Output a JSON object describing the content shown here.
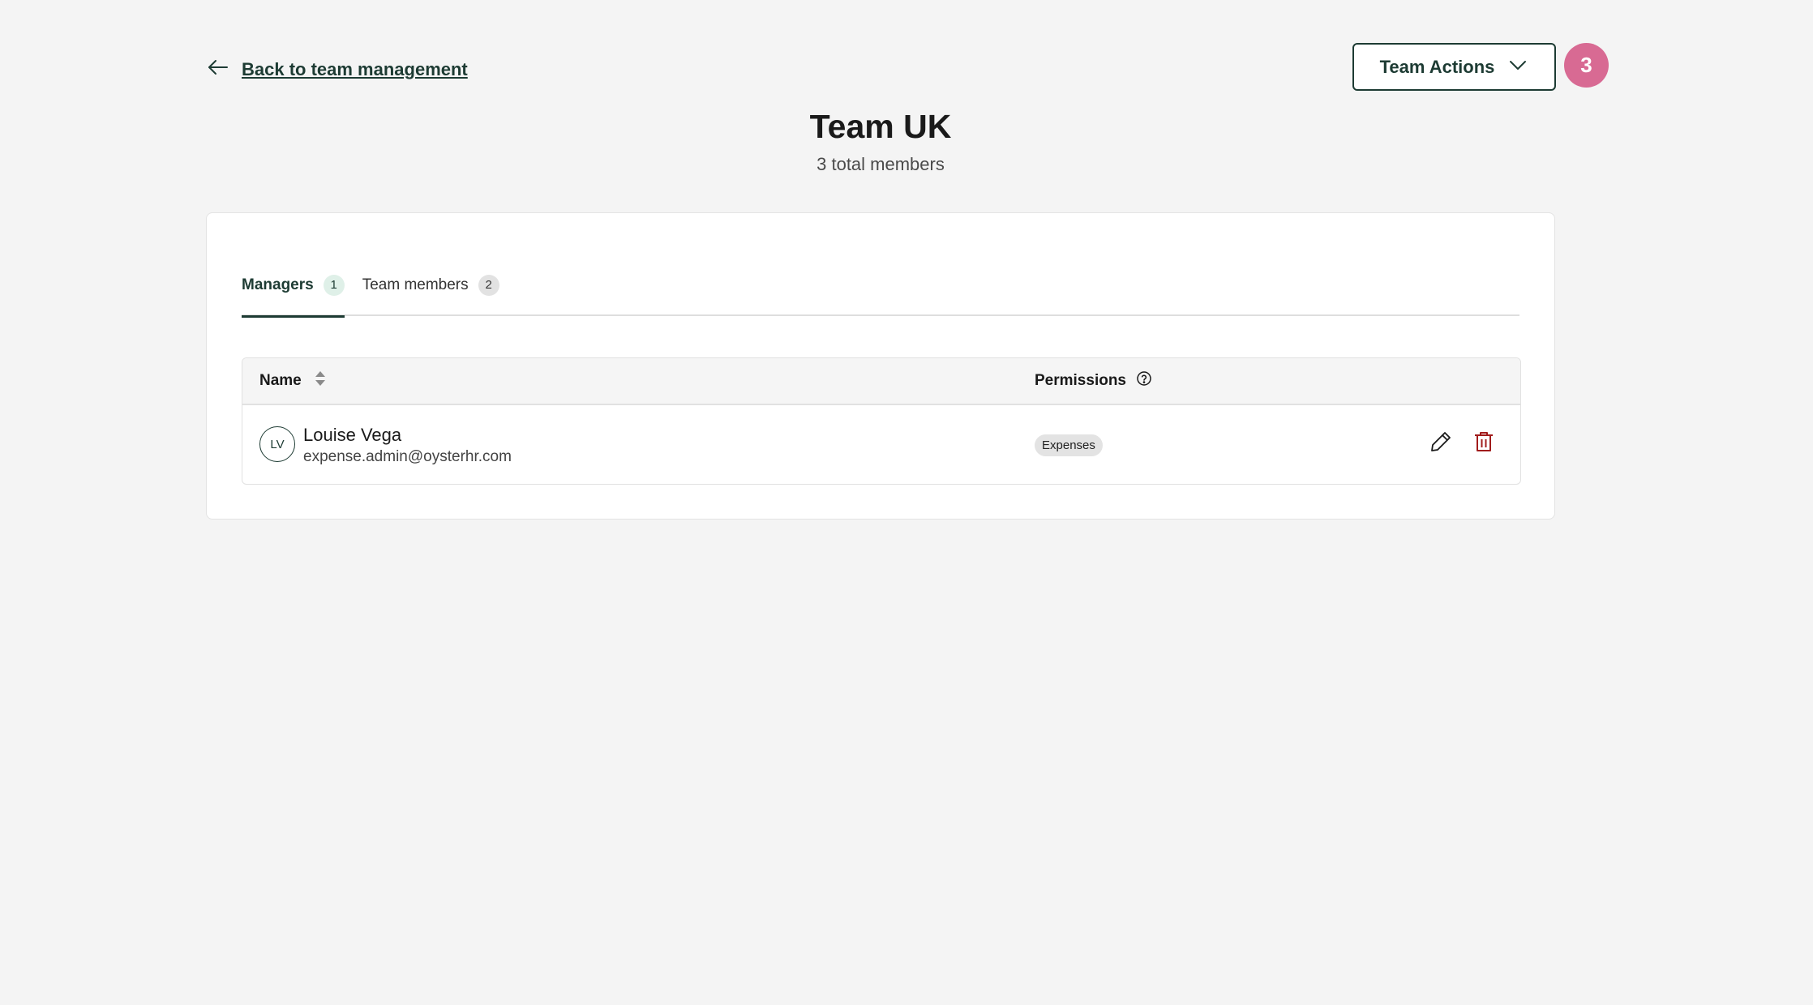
{
  "header": {
    "back_link_label": "Back to team management",
    "team_actions_label": "Team Actions",
    "step_badge": "3",
    "title": "Team UK",
    "subtitle": "3 total members"
  },
  "tabs": [
    {
      "label": "Managers",
      "count": "1",
      "active": true
    },
    {
      "label": "Team members",
      "count": "2",
      "active": false
    }
  ],
  "table": {
    "columns": {
      "name": "Name",
      "permissions": "Permissions"
    },
    "rows": [
      {
        "initials": "LV",
        "name": "Louise Vega",
        "email": "expense.admin@oysterhr.com",
        "permissions": [
          "Expenses"
        ]
      }
    ]
  },
  "colors": {
    "accent": "#1d3b33",
    "step_badge": "#d86a93",
    "delete": "#a11c1c",
    "background": "#f4f4f4"
  }
}
